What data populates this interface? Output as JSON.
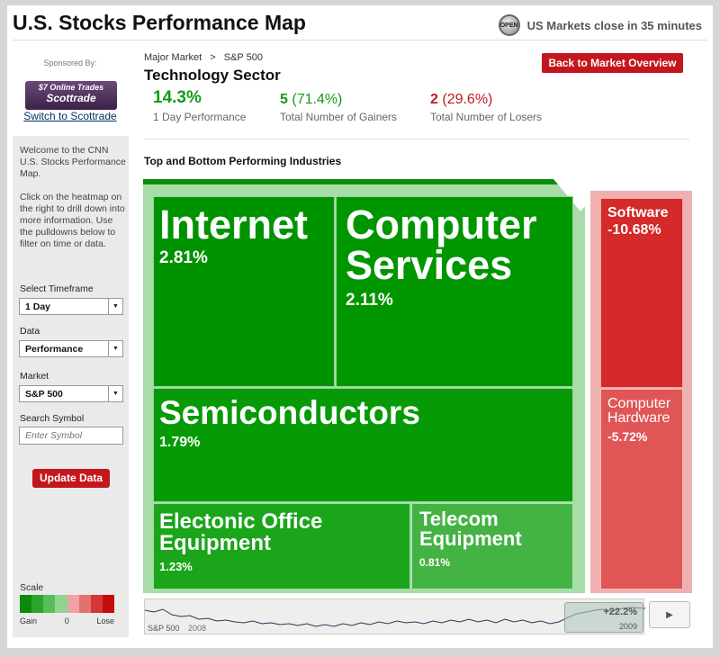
{
  "header": {
    "title": "U.S. Stocks Performance Map",
    "market_status": "US Markets close in 35 minutes",
    "open_badge": "OPEN"
  },
  "sponsor": {
    "label": "Sponsored By:",
    "logo_line1": "$7 Online Trades",
    "logo_line2": "Scottrade",
    "switch_link": "Switch to Scottrade"
  },
  "sidebar": {
    "welcome": "Welcome to the CNN U.S. Stocks Performance Map.",
    "instructions": "Click on the heatmap on the right to drill down into more information. Use the pulldowns below to filter on time or data.",
    "timeframe_label": "Select Timeframe",
    "timeframe_value": "1 Day",
    "data_label": "Data",
    "data_value": "Performance",
    "market_label": "Market",
    "market_value": "S&P 500",
    "search_label": "Search Symbol",
    "search_placeholder": "Enter Symbol",
    "update_button": "Update Data",
    "scale_label": "Scale",
    "scale_gain": "Gain",
    "scale_zero": "0",
    "scale_lose": "Lose",
    "scale_colors": [
      "#0a8a0a",
      "#2aa52a",
      "#58bd58",
      "#8fd48f",
      "#f1a3a3",
      "#e57070",
      "#d63636",
      "#c40c0c"
    ]
  },
  "breadcrumb": {
    "items": [
      "Major Market",
      "S&P 500"
    ],
    "separator": ">"
  },
  "sector": {
    "title": "Technology Sector",
    "back_button": "Back to Market Overview",
    "performance_value": "14.3%",
    "performance_label": "1 Day Performance",
    "gainers_count": "5",
    "gainers_pct": "(71.4%)",
    "gainers_label": "Total Number of Gainers",
    "losers_count": "2",
    "losers_pct": "(29.6%)",
    "losers_label": "Total Number of Losers"
  },
  "heatmap": {
    "section_title": "Top and Bottom Performing Industries",
    "gainers": [
      {
        "name": "Internet",
        "pct": "2.81%",
        "color": "#009300"
      },
      {
        "name": "Computer Services",
        "pct": "2.11%",
        "color": "#009600"
      },
      {
        "name": "Semiconductors",
        "pct": "1.79%",
        "color": "#069b06"
      },
      {
        "name": "Electonic Office Equipment",
        "pct": "1.23%",
        "color": "#1aa51a"
      },
      {
        "name": "Telecom Equipment",
        "pct": "0.81%",
        "color": "#43b343"
      }
    ],
    "losers": [
      {
        "name": "Software",
        "pct": "-10.68%",
        "color": "#d42a2a"
      },
      {
        "name": "Computer Hardware",
        "pct": "-5.72%",
        "color": "#e05555"
      }
    ]
  },
  "timeline": {
    "label": "S&P 500",
    "start_year": "2008",
    "end_year": "2009",
    "change": "+22.2%",
    "next_icon": "play-arrow-icon"
  }
}
